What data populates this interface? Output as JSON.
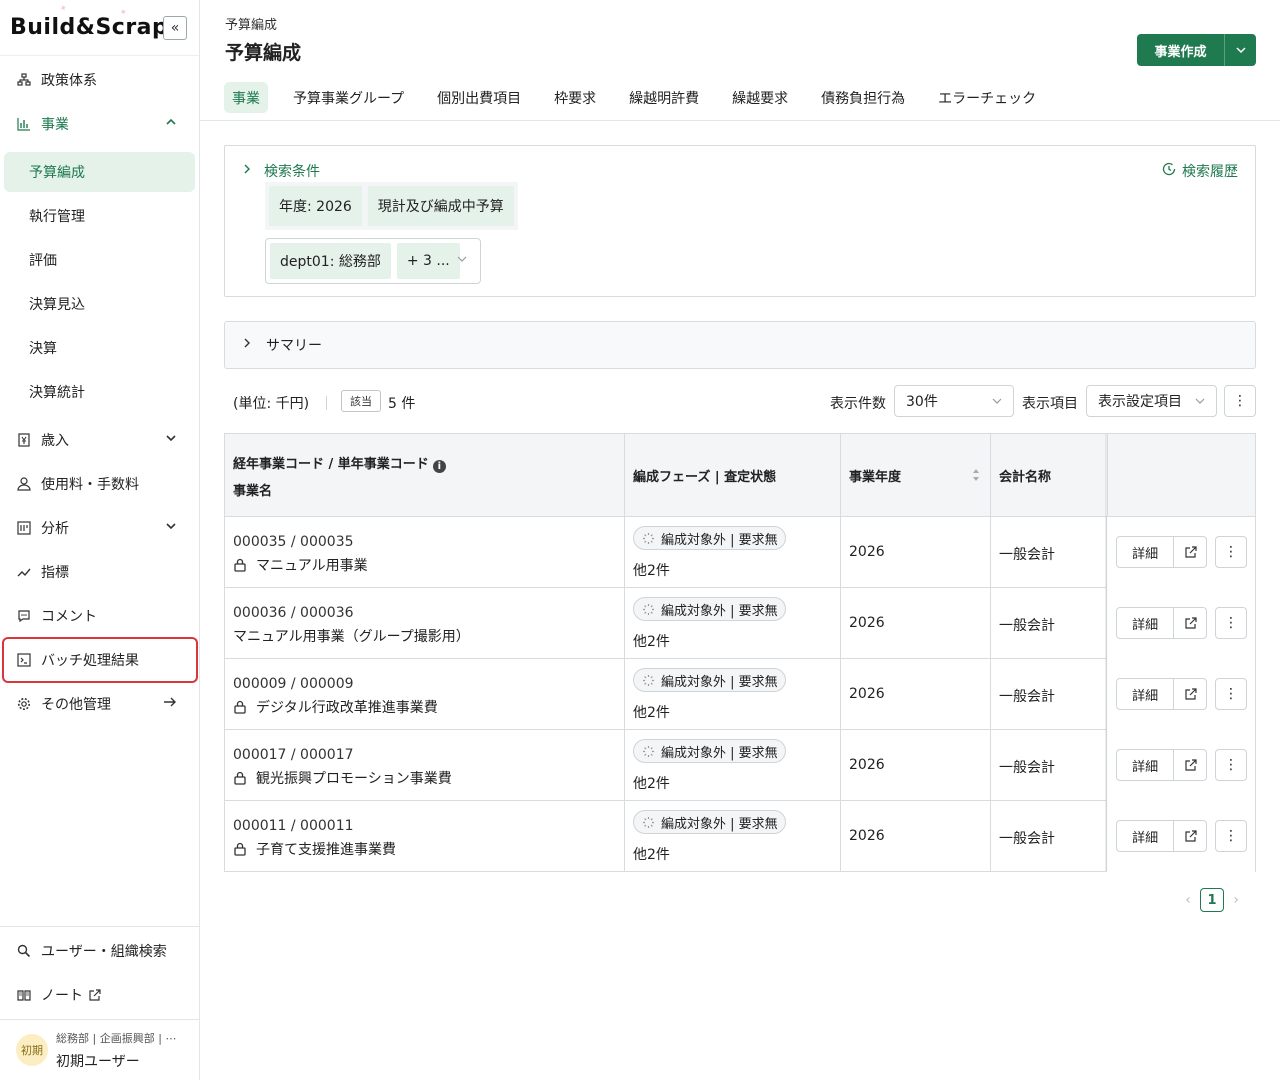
{
  "app": {
    "logo": "Build&Scrap",
    "collapse_label": "«"
  },
  "sidebar": {
    "items": [
      {
        "label": "政策体系",
        "icon": "org-chart-icon"
      },
      {
        "label": "事業",
        "icon": "bar-chart-icon",
        "expanded": true
      },
      {
        "label": "歳入",
        "icon": "revenue-icon"
      },
      {
        "label": "使用料・手数料",
        "icon": "fee-icon"
      },
      {
        "label": "分析",
        "icon": "analysis-icon"
      },
      {
        "label": "指標",
        "icon": "trend-icon"
      },
      {
        "label": "コメント",
        "icon": "comment-icon"
      },
      {
        "label": "バッチ処理結果",
        "icon": "terminal-icon",
        "highlighted": true
      },
      {
        "label": "その他管理",
        "icon": "gear-icon"
      }
    ],
    "sub_items": [
      {
        "label": "予算編成",
        "active": true
      },
      {
        "label": "執行管理"
      },
      {
        "label": "評価"
      },
      {
        "label": "決算見込"
      },
      {
        "label": "決算"
      },
      {
        "label": "決算統計"
      }
    ],
    "bottom_items": [
      {
        "label": "ユーザー・組織検索",
        "icon": "search-icon"
      },
      {
        "label": "ノート",
        "icon": "book-icon"
      }
    ],
    "user": {
      "avatar_text": "初期",
      "dept": "総務部 | 企画振興部 | ⋯",
      "name": "初期ユーザー"
    }
  },
  "header": {
    "breadcrumb": "予算編成",
    "title": "予算編成",
    "create_button": "事業作成"
  },
  "tabs": [
    {
      "label": "事業",
      "active": true
    },
    {
      "label": "予算事業グループ"
    },
    {
      "label": "個別出費項目"
    },
    {
      "label": "枠要求"
    },
    {
      "label": "繰越明許費"
    },
    {
      "label": "繰越要求"
    },
    {
      "label": "債務負担行為"
    },
    {
      "label": "エラーチェック"
    }
  ],
  "search": {
    "title": "検索条件",
    "history": "検索履歴",
    "chips": [
      "年度: 2026",
      "現計及び編成中予算"
    ],
    "dept_chip": "dept01: 総務部",
    "dept_more": "+ 3 ..."
  },
  "summary": {
    "label": "サマリー"
  },
  "toolbar": {
    "unit": "(単位: 千円)",
    "count_badge": "該当",
    "count_text": "5 件",
    "display_count_label": "表示件数",
    "display_count_value": "30件",
    "display_cols_label": "表示項目",
    "display_cols_value": "表示設定項目"
  },
  "table": {
    "headers": {
      "code_line1": "経年事業コード / 単年事業コード",
      "code_line2": "事業名",
      "phase": "編成フェーズ | 査定状態",
      "year": "事業年度",
      "account": "会計名称"
    },
    "detail_label": "詳細",
    "rows": [
      {
        "code": "000035 / 000035",
        "name": "マニュアル用事業",
        "locked": true,
        "phase": "編成対象外 | 要求無",
        "others": "他2件",
        "year": "2026",
        "account": "一般会計"
      },
      {
        "code": "000036 / 000036",
        "name": "マニュアル用事業（グループ撮影用）",
        "locked": false,
        "phase": "編成対象外 | 要求無",
        "others": "他2件",
        "year": "2026",
        "account": "一般会計"
      },
      {
        "code": "000009 / 000009",
        "name": "デジタル行政改革推進事業費",
        "locked": true,
        "phase": "編成対象外 | 要求無",
        "others": "他2件",
        "year": "2026",
        "account": "一般会計"
      },
      {
        "code": "000017 / 000017",
        "name": "観光振興プロモーション事業費",
        "locked": true,
        "phase": "編成対象外 | 要求無",
        "others": "他2件",
        "year": "2026",
        "account": "一般会計"
      },
      {
        "code": "000011 / 000011",
        "name": "子育て支援推進事業費",
        "locked": true,
        "phase": "編成対象外 | 要求無",
        "others": "他2件",
        "year": "2026",
        "account": "一般会計"
      }
    ]
  },
  "pagination": {
    "current": "1"
  },
  "colors": {
    "accent": "#1f7a4f",
    "accent_light": "#e4f2ea",
    "highlight_border": "#d9373c"
  }
}
